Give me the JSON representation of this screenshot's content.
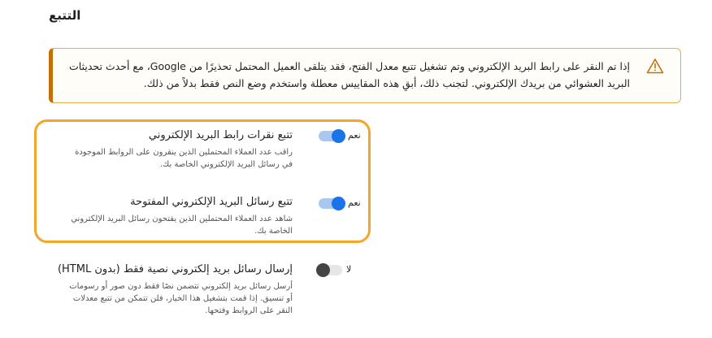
{
  "section": {
    "title": "التتبع"
  },
  "alert": {
    "icon": "warning-triangle-icon",
    "accent_color": "#c3700a",
    "line1": "إذا تم النقر على رابط البريد الإلكتروني وتم تشغيل تتبع معدل الفتح، فقد يتلقى العميل المحتمل تحذيرًا من Google، مع أحدث تحديثات",
    "line2": "البريد العشوائي من بريدك الإلكتروني. لتجنب ذلك، أبقِ هذه المقاييس معطلة واستخدم وضع النص فقط بدلاً من ذلك."
  },
  "settings": [
    {
      "title": "تتبع نقرات رابط البريد الإلكتروني",
      "desc_line1": "راقب عدد العملاء المحتملين الذين ينقرون على الروابط الموجودة",
      "desc_line2": "في رسائل البريد الإلكتروني الخاصة بك.",
      "toggle_label": "نعم",
      "enabled": true
    },
    {
      "title": "تتبع رسائل البريد الإلكتروني المفتوحة",
      "desc_line1": "شاهد عدد العملاء المحتملين الذين يفتحون رسائل البريد الإلكتروني",
      "desc_line2": "الخاصة بك.",
      "toggle_label": "نعم",
      "enabled": true
    },
    {
      "title": "إرسال رسائل بريد إلكتروني نصية فقط (بدون HTML)",
      "desc_line1": "أرسل رسائل بريد إلكتروني تتضمن نصًا فقط دون صور أو رسومات",
      "desc_line2": "أو تنسيق. إذا قمت بتشغيل هذا الخيار، فلن تتمكن من تتبع معدلات",
      "desc_line3": "النقر على الروابط وفتحها.",
      "toggle_label": "لا",
      "enabled": false
    }
  ],
  "colors": {
    "highlight_border": "#f4a62a",
    "toggle_on": "#1a73e8",
    "toggle_off": "#444444"
  }
}
